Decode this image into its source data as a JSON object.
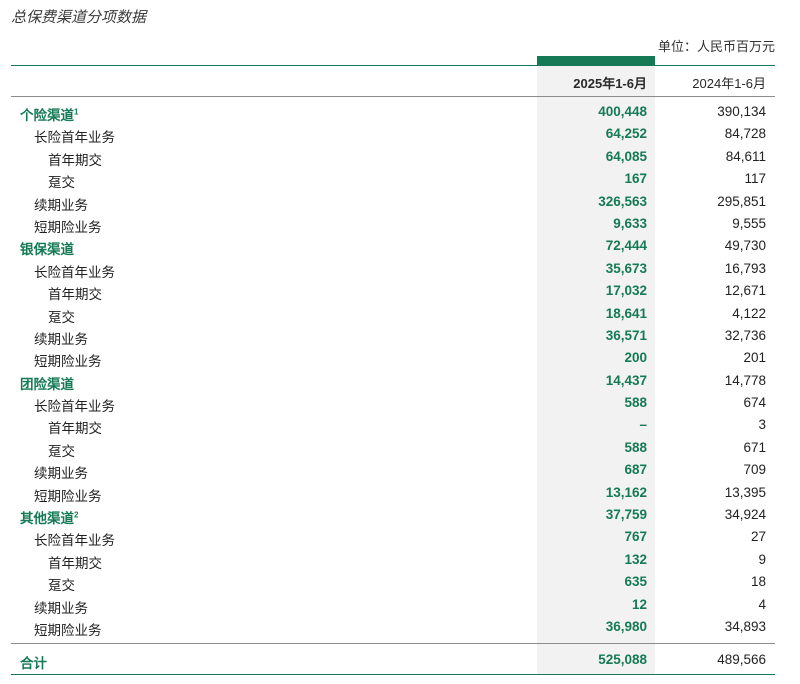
{
  "title": "总保费渠道分项数据",
  "unit_label": "单位：人民币百万元",
  "colors": {
    "accent_green": "#157a55",
    "current_column_bg": "#f2f2f2"
  },
  "columns": {
    "current": "2025年1-6月",
    "prior": "2024年1-6月"
  },
  "rows": [
    {
      "label": "个险渠道",
      "sup": "1",
      "level": 0,
      "current": "400,448",
      "prior": "390,134"
    },
    {
      "label": "长险首年业务",
      "sup": "",
      "level": 1,
      "current": "64,252",
      "prior": "84,728"
    },
    {
      "label": "首年期交",
      "sup": "",
      "level": 2,
      "current": "64,085",
      "prior": "84,611"
    },
    {
      "label": "趸交",
      "sup": "",
      "level": 2,
      "current": "167",
      "prior": "117"
    },
    {
      "label": "续期业务",
      "sup": "",
      "level": 1,
      "current": "326,563",
      "prior": "295,851"
    },
    {
      "label": "短期险业务",
      "sup": "",
      "level": 1,
      "current": "9,633",
      "prior": "9,555"
    },
    {
      "label": "银保渠道",
      "sup": "",
      "level": 0,
      "current": "72,444",
      "prior": "49,730"
    },
    {
      "label": "长险首年业务",
      "sup": "",
      "level": 1,
      "current": "35,673",
      "prior": "16,793"
    },
    {
      "label": "首年期交",
      "sup": "",
      "level": 2,
      "current": "17,032",
      "prior": "12,671"
    },
    {
      "label": "趸交",
      "sup": "",
      "level": 2,
      "current": "18,641",
      "prior": "4,122"
    },
    {
      "label": "续期业务",
      "sup": "",
      "level": 1,
      "current": "36,571",
      "prior": "32,736"
    },
    {
      "label": "短期险业务",
      "sup": "",
      "level": 1,
      "current": "200",
      "prior": "201"
    },
    {
      "label": "团险渠道",
      "sup": "",
      "level": 0,
      "current": "14,437",
      "prior": "14,778"
    },
    {
      "label": "长险首年业务",
      "sup": "",
      "level": 1,
      "current": "588",
      "prior": "674"
    },
    {
      "label": "首年期交",
      "sup": "",
      "level": 2,
      "current": "–",
      "prior": "3"
    },
    {
      "label": "趸交",
      "sup": "",
      "level": 2,
      "current": "588",
      "prior": "671"
    },
    {
      "label": "续期业务",
      "sup": "",
      "level": 1,
      "current": "687",
      "prior": "709"
    },
    {
      "label": "短期险业务",
      "sup": "",
      "level": 1,
      "current": "13,162",
      "prior": "13,395"
    },
    {
      "label": "其他渠道",
      "sup": "2",
      "level": 0,
      "current": "37,759",
      "prior": "34,924"
    },
    {
      "label": "长险首年业务",
      "sup": "",
      "level": 1,
      "current": "767",
      "prior": "27"
    },
    {
      "label": "首年期交",
      "sup": "",
      "level": 2,
      "current": "132",
      "prior": "9"
    },
    {
      "label": "趸交",
      "sup": "",
      "level": 2,
      "current": "635",
      "prior": "18"
    },
    {
      "label": "续期业务",
      "sup": "",
      "level": 1,
      "current": "12",
      "prior": "4"
    },
    {
      "label": "短期险业务",
      "sup": "",
      "level": 1,
      "current": "36,980",
      "prior": "34,893"
    }
  ],
  "total": {
    "label": "合计",
    "current": "525,088",
    "prior": "489,566"
  }
}
